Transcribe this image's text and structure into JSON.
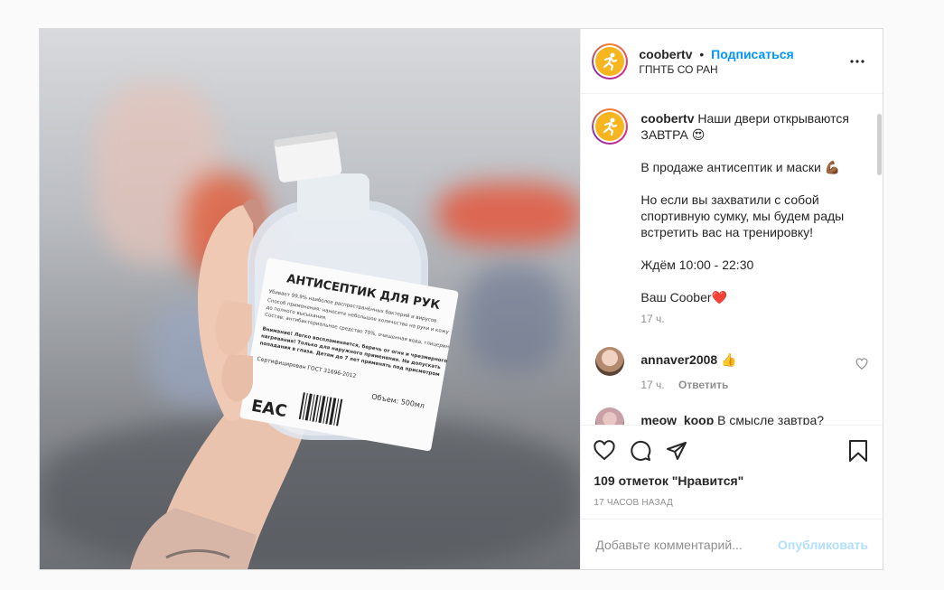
{
  "post": {
    "username": "coobertv",
    "separator": "•",
    "follow_label": "Подписаться",
    "location": "ГПНТБ СО РАН"
  },
  "photo": {
    "label_title": "АНТИСЕПТИК ДЛЯ РУК",
    "label_line1": "Убивает 99,9% наиболее распространённых бактерий и вирусов",
    "label_line2": "Способ применения: нанесите небольшое количество на руки и кожу",
    "label_line3": "до полного высыхания.",
    "label_line4": "Состав: антибактериальное средство 70%, очищенная вода, глицерин",
    "label_warning1": "Внимание! Легко воспламеняется, беречь от огня и чрезмерного",
    "label_warning2": "нагревания! Только для наружного применения. Не допускать",
    "label_warning3": "попадания в глаза. Детям до 7 лет применять под присмотром",
    "label_cert": "Сертифицирован ГОСТ 31696-2012",
    "label_volume": "Объем: 500мл",
    "label_eac": "EAC"
  },
  "caption": {
    "username": "coobertv",
    "paragraphs": [
      "Наши двери открываются ЗАВТРА 😍",
      "В продаже антисептик и маски 💪🏾",
      "Но если вы захватили с собой спортивную сумку, мы будем рады встретить вас на тренировку!",
      "Ждём 10:00 - 22:30",
      "Ваш Coober❤️"
    ],
    "time": "17 ч."
  },
  "comments": [
    {
      "username": "annaver2008",
      "text": "👍",
      "time": "17 ч.",
      "reply": "Ответить"
    },
    {
      "username": "meow_koop",
      "text": "В смысле завтра?",
      "time": "",
      "reply": ""
    }
  ],
  "actions": {
    "likes": "109 отметок \"Нравится\"",
    "posted": "17 часов назад"
  },
  "add_comment": {
    "placeholder": "Добавьте комментарий...",
    "publish": "Опубликовать"
  },
  "colors": {
    "link": "#0095f6",
    "publish_disabled": "#b2dffc",
    "meta": "#8e8e8e",
    "avatar_core": "#f7b520"
  }
}
